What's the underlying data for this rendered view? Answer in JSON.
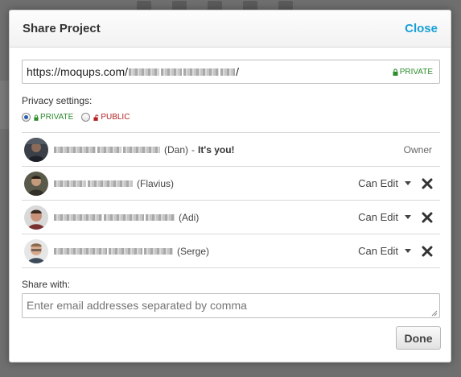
{
  "dialog": {
    "title": "Share Project",
    "close_label": "Close"
  },
  "url_field": {
    "visible_prefix": "https://moqups.com/",
    "visible_suffix": "/",
    "badge": "PRIVATE",
    "badge_icon": "lock-icon"
  },
  "privacy": {
    "label": "Privacy settings:",
    "options": [
      {
        "label": "PRIVATE",
        "icon": "lock-icon",
        "selected": true,
        "color": "#2e8b2e"
      },
      {
        "label": "PUBLIC",
        "icon": "unlock-icon",
        "selected": false,
        "color": "#b52020"
      }
    ]
  },
  "members": [
    {
      "nick": "(Dan)",
      "separator": "-",
      "you_label": "It's you!",
      "role": "Owner"
    },
    {
      "nick": "(Flavius)",
      "role": "Can Edit"
    },
    {
      "nick": "(Adi)",
      "role": "Can Edit"
    },
    {
      "nick": "(Serge)",
      "role": "Can Edit"
    }
  ],
  "share": {
    "label": "Share with:",
    "placeholder": "Enter email addresses separated by comma"
  },
  "footer": {
    "done_label": "Done"
  },
  "colors": {
    "accent_link": "#18a0d6",
    "private_green": "#2e8b2e",
    "public_red": "#b52020"
  }
}
